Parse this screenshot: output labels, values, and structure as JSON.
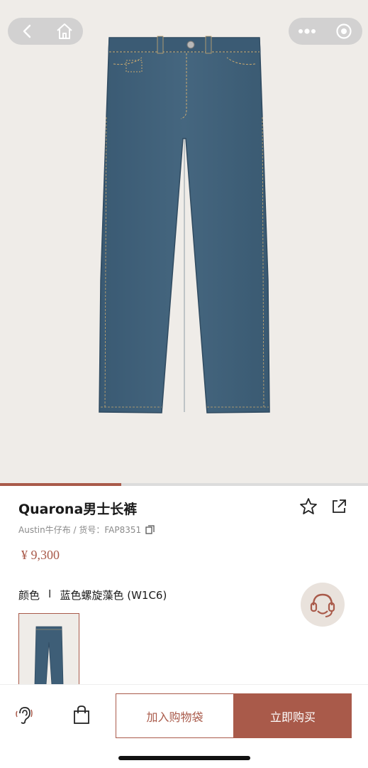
{
  "product": {
    "title": "Quarona男士长裤",
    "subline": "Austin牛仔布 / 货号：FAP8351",
    "price": "¥ 9,300",
    "color_label": "颜色",
    "color_sep": "I",
    "color_value": "蓝色螺旋藻色 (W1C6)"
  },
  "gallery": {
    "progress_fraction": 0.33
  },
  "actions": {
    "add_to_bag": "加入购物袋",
    "buy_now": "立即购买"
  },
  "icons": {
    "back": "chevron-left-icon",
    "home": "home-icon",
    "more": "more-dots-icon",
    "close": "target-circle-icon",
    "favorite": "star-icon",
    "share": "share-icon",
    "copy": "copy-icon",
    "customer_service": "headset-icon",
    "bag": "shopping-bag-icon",
    "advisor": "ear-icon"
  },
  "colors": {
    "accent": "#a95a4a",
    "hero_bg": "#efece8",
    "denim": "#3f5f78"
  }
}
